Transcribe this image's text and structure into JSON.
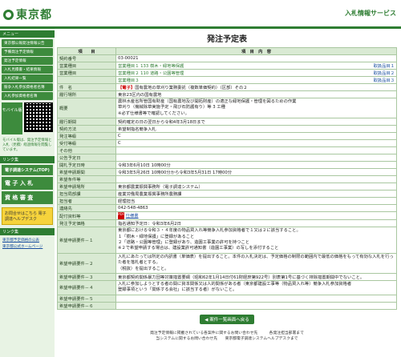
{
  "header": {
    "logo": "東京都",
    "service": "入札情報サービス"
  },
  "sidebar": {
    "menu_title": "メニュー",
    "items": [
      "東京都公報発注情報公告",
      "予備発注予定情報",
      "発注予定情報",
      "入札見積書・結果情報",
      "入札結果一覧",
      "競争入札参加資格者名簿",
      "入札参加資格者名簿"
    ],
    "mobile": "モバイル版",
    "mobile_note": "モバイル版は、発注予定情報と入札（見積）経過情報を閲覧しています。",
    "links_title": "リンク集",
    "big1": "電子調達システム(TOP)",
    "big2": "電 子 入 札",
    "big3": "資 格 審 査",
    "yellow": "お問合せはこちら 電子調達ヘルプデスク",
    "bottom_links": [
      "東京都予定価格の公表",
      "東京都公式ホームページ"
    ]
  },
  "main": {
    "title": "発注予定表",
    "col_item": "項　　目",
    "col_content": "項　目　内　容",
    "rows": [
      {
        "label": "契約番号",
        "value": "03-00021"
      },
      {
        "label": "営業種目",
        "value": "営業種目１ 133 樹木・緑地等保護",
        "right": "取扱品目１"
      },
      {
        "label": "営業種目",
        "value": "営業種目２ 110 道路・公園等管理",
        "right": "取扱品目２"
      },
      {
        "label": "",
        "value": "営業種目３",
        "right": "取扱品目３"
      },
      {
        "label": "件　名",
        "tag": "【電子】",
        "value": "国有農地の草刈り業務委託（複数単価契約）（区部）その２"
      },
      {
        "label": "履行場所",
        "value": "東京23区内の国有農地"
      },
      {
        "label": "概要",
        "multi": [
          "農林水産省所管国有財産（国有農地及び開拓財産）の適正な緑地保護・管理を図るための作業",
          "",
          "草刈り（機械除草実施予定・飛び石防護有り）等 3 工種",
          "",
          "※必ず仕様書等で確認してください。"
        ]
      },
      {
        "label": "履行期間",
        "value": "契約確定の日の翌日から令和4年3月18日まで"
      },
      {
        "label": "契約方法",
        "value": "希望制指名競争入札"
      },
      {
        "label": "発注等級",
        "value": "C"
      },
      {
        "label": "受付等級",
        "value": "C"
      },
      {
        "label": "その他",
        "value": ""
      },
      {
        "label": "公告予定日",
        "value": ""
      },
      {
        "label": "開札予定日時",
        "value": "令和3年6月10日 10時00分"
      },
      {
        "label": "希望申請期間",
        "value": "令和3年5月26日 10時00分から令和3年5月31日 17時00分"
      },
      {
        "label": "希望条件等",
        "value": ""
      },
      {
        "label": "希望申請場所",
        "value": "東京都農業振興事務所（電子調達システム）"
      },
      {
        "label": "担当局部課",
        "value": "産業労働局農業振興事務所農務課"
      },
      {
        "label": "担当者",
        "value": "経理担当"
      },
      {
        "label": "連絡先",
        "value": "042-548-4863"
      },
      {
        "label": "配付資料等",
        "pdf": "仕様書"
      },
      {
        "label": "発注予定価格",
        "value": "指名通知予定日：令和3年6月2日"
      },
      {
        "label": "希望申請要件－１",
        "multi": [
          "東京都における令和３・４年度の物品買入れ等競争入札参加資格者で１又は２に該当すること。",
          "１「樹木・緑地保護」に登録があること",
          "２「道路・公園等管理」に登録があり、造園工事業の許可を持つこと",
          "※２で希望申請する場合は、建設業許可通知書（造園工事業）の写しを添付すること"
        ]
      },
      {
        "label": "希望申請要件－２",
        "multi": [
          "入札にあたっては所定の内訳書（単価表）を提出すること。本件の入札決定は、予定価格の制限の範囲内で最低の価格をもって有効な入札を行った者を落札者とする。",
          "（税抜）を提出すること。"
        ]
      },
      {
        "label": "希望申請要件－３",
        "value": "東京都契約関係暴力団等対策措置要綱（昭和62年1月14日付61財経庶第922号）別表第1号に基づく排除措置期間中でないこと。"
      },
      {
        "label": "希望申請要件－４",
        "multi": [
          "入札に参加しようとする者の間に資本関係又は人的関係がある者（東京都建設工事等（物品買入れ等）競争入札参加資格者",
          "登録事項という「関係する会社」に該当する者）がないこと。"
        ]
      },
      {
        "label": "希望申請要件－５",
        "value": ""
      },
      {
        "label": "希望申請要件－６",
        "value": ""
      }
    ],
    "back": "◀ 案件一覧画面へ戻る"
  },
  "footer": {
    "line1": "発注予定情報に掲載されている各案件に関するお問い合わせ先　　　各発注担当部署まで",
    "line2": "当システムに関するお問い合わせ先　　東京都電子調達システムヘルプデスクまで"
  }
}
